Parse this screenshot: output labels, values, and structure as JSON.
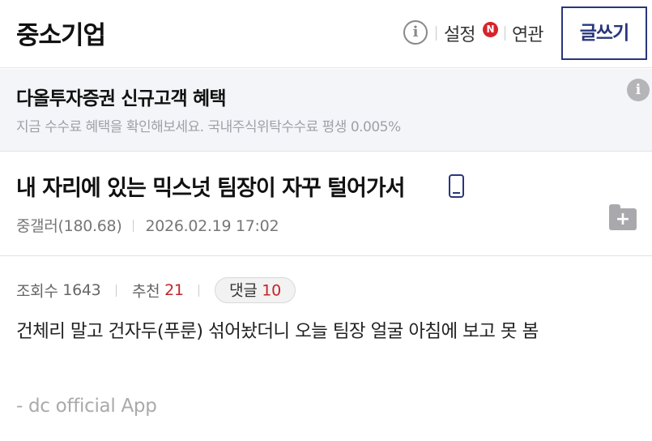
{
  "header": {
    "gallery_title": "중소기업",
    "info_glyph": "i",
    "settings_label": "설정",
    "new_badge": "N",
    "related_label": "연관",
    "write_label": "글쓰기"
  },
  "ad": {
    "title": "다올투자증권 신규고객 혜택",
    "description": "지금 수수료 혜택을 확인해보세요. 국내주식위탁수수료 평생 0.005%",
    "info_glyph": "i"
  },
  "post": {
    "title": "내 자리에 있는 믹스넛 팀장이 자꾸 털어가서",
    "author": "중갤러(180.68)",
    "datetime": "2026.02.19 17:02",
    "folder_plus": "+",
    "stats": {
      "views_label": "조회수",
      "views": "1643",
      "recommend_label": "추천",
      "recommend": "21",
      "comments_label": "댓글",
      "comments": "10"
    },
    "content": "건체리 말고 건자두(푸룬) 섞어놨더니 오늘 팀장 얼굴 아침에 보고 못 봄",
    "signature": "- dc official App"
  },
  "colors": {
    "accent_navy": "#29367c",
    "badge_red": "#d8232a",
    "count_red": "#c5222a",
    "ad_background": "#f4f5f9"
  },
  "icons": {
    "info": "info-icon",
    "new_badge": "new-badge-icon",
    "mobile": "mobile-phone-icon",
    "folder_add": "folder-add-icon"
  }
}
